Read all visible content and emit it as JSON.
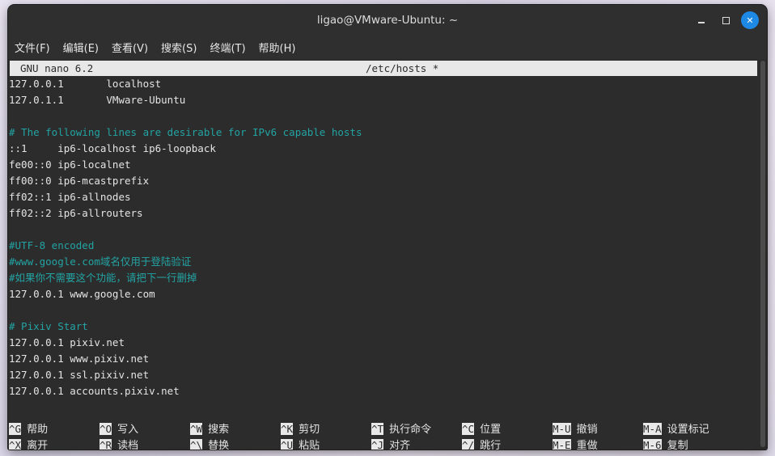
{
  "window": {
    "title": "ligao@VMware-Ubuntu: ~"
  },
  "menubar": {
    "items": [
      "文件(F)",
      "编辑(E)",
      "查看(V)",
      "搜索(S)",
      "终端(T)",
      "帮助(H)"
    ]
  },
  "nano": {
    "version": "GNU nano 6.2",
    "filename": "/etc/hosts *"
  },
  "editor": {
    "lines": [
      {
        "text": "127.0.0.1       localhost",
        "kind": "text"
      },
      {
        "text": "127.0.1.1       VMware-Ubuntu",
        "kind": "text"
      },
      {
        "text": "",
        "kind": "text"
      },
      {
        "text": "# The following lines are desirable for IPv6 capable hosts",
        "kind": "comment"
      },
      {
        "text": "::1     ip6-localhost ip6-loopback",
        "kind": "text"
      },
      {
        "text": "fe00::0 ip6-localnet",
        "kind": "text"
      },
      {
        "text": "ff00::0 ip6-mcastprefix",
        "kind": "text"
      },
      {
        "text": "ff02::1 ip6-allnodes",
        "kind": "text"
      },
      {
        "text": "ff02::2 ip6-allrouters",
        "kind": "text"
      },
      {
        "text": "",
        "kind": "text"
      },
      {
        "text": "#UTF-8 encoded",
        "kind": "comment"
      },
      {
        "text": "#www.google.com域名仅用于登陆验证",
        "kind": "comment"
      },
      {
        "text": "#如果你不需要这个功能，请把下一行删掉",
        "kind": "comment"
      },
      {
        "text": "127.0.0.1 www.google.com",
        "kind": "text"
      },
      {
        "text": "",
        "kind": "text"
      },
      {
        "text": "# Pixiv Start",
        "kind": "comment"
      },
      {
        "text": "127.0.0.1 pixiv.net",
        "kind": "text"
      },
      {
        "text": "127.0.0.1 www.pixiv.net",
        "kind": "text"
      },
      {
        "text": "127.0.0.1 ssl.pixiv.net",
        "kind": "text"
      },
      {
        "text": "127.0.0.1 accounts.pixiv.net",
        "kind": "text"
      }
    ]
  },
  "shortcuts": {
    "row1": [
      {
        "key": "^G",
        "label": "帮助"
      },
      {
        "key": "^O",
        "label": "写入"
      },
      {
        "key": "^W",
        "label": "搜索"
      },
      {
        "key": "^K",
        "label": "剪切"
      },
      {
        "key": "^T",
        "label": "执行命令"
      },
      {
        "key": "^C",
        "label": "位置"
      },
      {
        "key": "M-U",
        "label": "撤销"
      },
      {
        "key": "M-A",
        "label": "设置标记"
      }
    ],
    "row2": [
      {
        "key": "^X",
        "label": "离开"
      },
      {
        "key": "^R",
        "label": "读档"
      },
      {
        "key": "^\\",
        "label": "替换"
      },
      {
        "key": "^U",
        "label": "粘贴"
      },
      {
        "key": "^J",
        "label": "对齐"
      },
      {
        "key": "^/",
        "label": "跳行"
      },
      {
        "key": "M-E",
        "label": "重做"
      },
      {
        "key": "M-6",
        "label": "复制"
      }
    ]
  },
  "colors": {
    "comment": "#23a3a3",
    "text": "#e4e4e4",
    "background": "#2c2c2c",
    "close_button": "#1e88e5"
  }
}
